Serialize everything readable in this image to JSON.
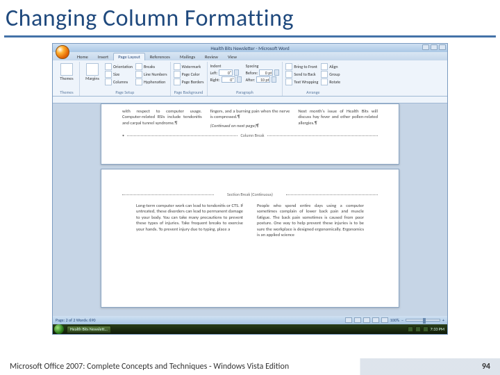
{
  "slide": {
    "title": "Changing Column Formatting",
    "footer_text": "Microsoft Office 2007: Complete Concepts and Techniques - Windows Vista Edition",
    "page_number": "94"
  },
  "word_window": {
    "title": "Health Bits Newsletter - Microsoft Word",
    "tabs": [
      "Home",
      "Insert",
      "Page Layout",
      "References",
      "Mailings",
      "Review",
      "View"
    ],
    "active_tab_index": 2
  },
  "ribbon": {
    "themes": {
      "label": "Themes",
      "btn": "Themes"
    },
    "page_setup": {
      "label": "Page Setup",
      "margins": "Margins",
      "orientation": "Orientation",
      "size": "Size",
      "columns": "Columns",
      "breaks": "Breaks",
      "line_numbers": "Line Numbers",
      "hyphenation": "Hyphenation"
    },
    "page_background": {
      "label": "Page Background",
      "watermark": "Watermark",
      "page_color": "Page Color",
      "page_borders": "Page Borders"
    },
    "paragraph": {
      "label": "Paragraph",
      "indent_label": "Indent",
      "spacing_label": "Spacing",
      "left_label": "Left:",
      "right_label": "Right:",
      "before_label": "Before:",
      "after_label": "After:",
      "left_val": "0\"",
      "right_val": "0\"",
      "before_val": "0 pt",
      "after_val": "10 pt"
    },
    "arrange": {
      "label": "Arrange",
      "bring_front": "Bring to Front",
      "send_back": "Send to Back",
      "text_wrap": "Text Wrapping",
      "align": "Align",
      "group": "Group",
      "rotate": "Rotate"
    }
  },
  "document": {
    "page1": {
      "col1": "with respect to computer usage. Computer-related RSIs include tendonitis and carpal tunnel syndrome.¶",
      "col2_line1": "fingers, and a burning pain when the nerve is compressed.¶",
      "col2_continued": "(Continued on next page)¶",
      "col3": "Next month's issue of Health Bits will discuss hay fever and other pollen-related allergies.¶"
    },
    "column_break_label": "Column Break",
    "section_break_label": "Section Break (Continuous)",
    "page2": {
      "col1": "Long-term computer work can lead to tendonitis or CTS. If untreated, these disorders can lead to permanent damage to your body. You can take many precautions to prevent these types of injuries. Take frequent breaks to exercise your hands. To prevent injury due to typing, place a",
      "col2": "People who spend entire days using a computer sometimes complain of lower back pain and muscle fatigue. The back pain sometimes is caused from poor posture. One way to help prevent these injuries is to be sure the workplace is designed ergonomically. Ergonomics is an applied science"
    }
  },
  "statusbar": {
    "left": "Page: 2 of 2   Words: 690",
    "zoom": "100%"
  },
  "taskbar": {
    "task_label": "Health Bits Newslett...",
    "time": "7:33 PM"
  }
}
